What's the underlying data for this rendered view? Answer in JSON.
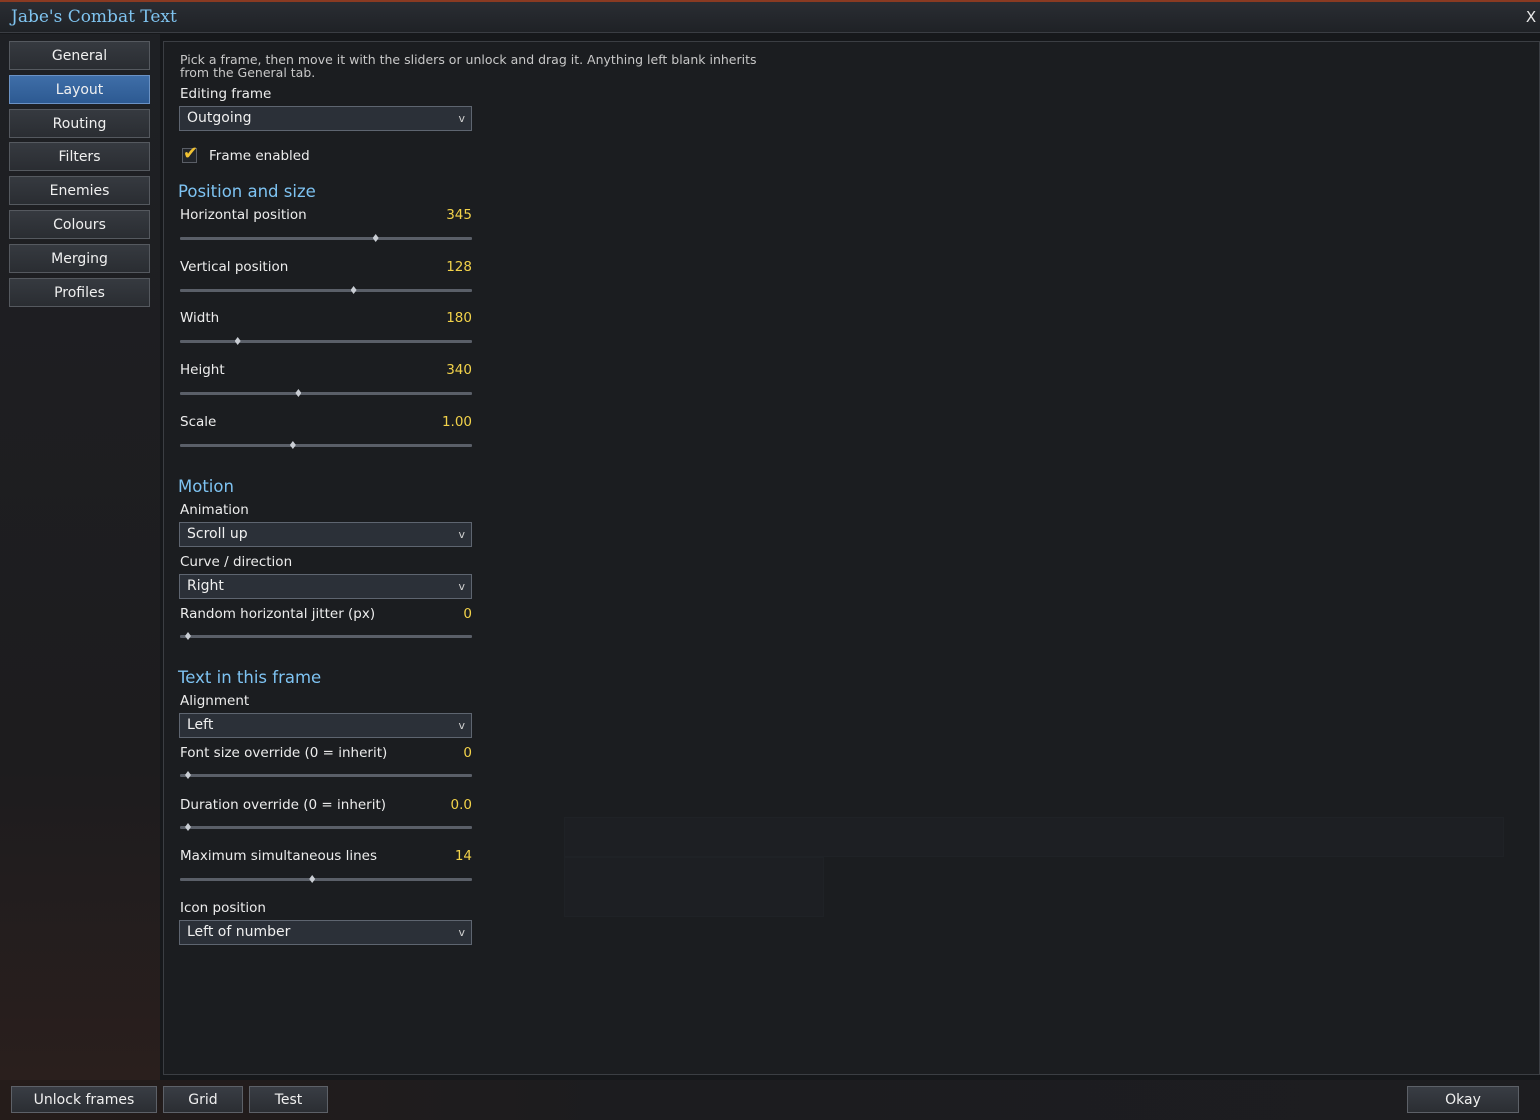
{
  "window": {
    "title": "Jabe's Combat Text",
    "close_label": "X"
  },
  "sidebar": {
    "items": [
      {
        "label": "General",
        "active": false
      },
      {
        "label": "Layout",
        "active": true
      },
      {
        "label": "Routing",
        "active": false
      },
      {
        "label": "Filters",
        "active": false
      },
      {
        "label": "Enemies",
        "active": false
      },
      {
        "label": "Colours",
        "active": false
      },
      {
        "label": "Merging",
        "active": false
      },
      {
        "label": "Profiles",
        "active": false
      }
    ]
  },
  "layout_page": {
    "intro_line1": "Pick a frame, then move it with the sliders or unlock and drag it. Anything left blank inherits",
    "intro_line2": "from the General tab.",
    "editing_frame": {
      "label": "Editing frame",
      "value": "Outgoing"
    },
    "frame_enabled": {
      "label": "Frame enabled",
      "checked": true
    },
    "position_section": {
      "title": "Position and size",
      "horizontal": {
        "label": "Horizontal position",
        "value": "345",
        "fraction": 0.68
      },
      "vertical": {
        "label": "Vertical position",
        "value": "128",
        "fraction": 0.6
      },
      "width": {
        "label": "Width",
        "value": "180",
        "fraction": 0.18
      },
      "height": {
        "label": "Height",
        "value": "340",
        "fraction": 0.4
      },
      "scale": {
        "label": "Scale",
        "value": "1.00",
        "fraction": 0.38
      }
    },
    "motion_section": {
      "title": "Motion",
      "animation": {
        "label": "Animation",
        "value": "Scroll up"
      },
      "curve": {
        "label": "Curve / direction",
        "value": "Right"
      },
      "jitter": {
        "label": "Random horizontal jitter (px)",
        "value": "0",
        "fraction": 0.0
      }
    },
    "text_section": {
      "title": "Text in this frame",
      "alignment": {
        "label": "Alignment",
        "value": "Left"
      },
      "font_size": {
        "label": "Font size override (0 = inherit)",
        "value": "0",
        "fraction": 0.0
      },
      "duration": {
        "label": "Duration override (0 = inherit)",
        "value": "0.0",
        "fraction": 0.0
      },
      "max_lines": {
        "label": "Maximum simultaneous lines",
        "value": "14",
        "fraction": 0.45
      },
      "icon_position": {
        "label": "Icon position",
        "value": "Left of number"
      }
    }
  },
  "footer": {
    "unlock_label": "Unlock frames",
    "grid_label": "Grid",
    "test_label": "Test",
    "okay_label": "Okay"
  },
  "dropdown_arrow_glyph": "v",
  "colors": {
    "accent_blue": "#7ec3f2",
    "value_yellow": "#f2d24a",
    "active_tab": "#3f6ea8",
    "check_yellow": "#f1c232"
  }
}
